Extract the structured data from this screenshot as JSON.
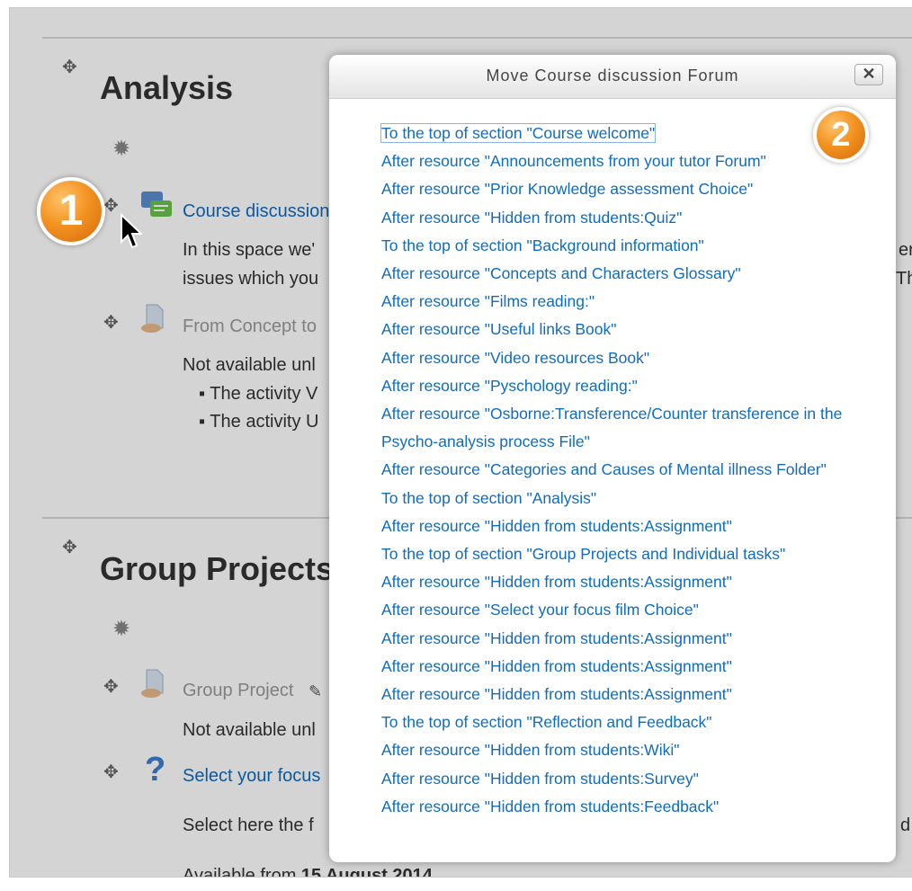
{
  "background": {
    "sections": [
      {
        "title": "Analysis"
      },
      {
        "title": "Group Projects"
      }
    ],
    "activities": {
      "course_discussion_link": "Course discussion",
      "course_discussion_desc_line1": "In this space we'",
      "course_discussion_desc_line2": "issues which you",
      "from_concept_link": "From Concept to",
      "not_available_1": "Not available unl",
      "bullet_1": "The activity V",
      "bullet_2": "The activity U",
      "group_project_link": "Group Project",
      "not_available_2": "Not available unl",
      "select_focus_link": "Select your focus",
      "select_focus_desc": "Select here the f",
      "available_from_prefix": "Available from",
      "available_from_date": "15 August 2014",
      "right_edge_1": "er",
      "right_edge_2": "Th",
      "right_edge_3": "d"
    }
  },
  "badges": {
    "badge1": "1",
    "badge2": "2"
  },
  "dialog": {
    "title": "Move Course discussion Forum",
    "close_label": "✕",
    "options": [
      "To the top of section \"Course welcome\"",
      "After resource \"Announcements from your tutor Forum\"",
      "After resource \"Prior Knowledge assessment Choice\"",
      "After resource \"Hidden from students:Quiz\"",
      "To the top of section \"Background information\"",
      "After resource \"Concepts and Characters Glossary\"",
      "After resource \"Films reading:\"",
      "After resource \"Useful links Book\"",
      "After resource \"Video resources Book\"",
      "After resource \"Pyschology reading:\"",
      "After resource \"Osborne:Transference/Counter transference in the Psycho-analysis process File\"",
      "After resource \"Categories and Causes of Mental illness Folder\"",
      "To the top of section \"Analysis\"",
      "After resource \"Hidden from students:Assignment\"",
      "To the top of section \"Group Projects and Individual tasks\"",
      "After resource \"Hidden from students:Assignment\"",
      "After resource \"Select your focus film Choice\"",
      "After resource \"Hidden from students:Assignment\"",
      "After resource \"Hidden from students:Assignment\"",
      "After resource \"Hidden from students:Assignment\"",
      "To the top of section \"Reflection and Feedback\"",
      "After resource \"Hidden from students:Wiki\"",
      "After resource \"Hidden from students:Survey\"",
      "After resource \"Hidden from students:Feedback\""
    ]
  },
  "colors": {
    "link": "#0f6cbf",
    "badge": "#f39322"
  },
  "icons": [
    "move-icon",
    "gear-icon",
    "forum-icon",
    "resource-icon",
    "question-icon",
    "edit-icon",
    "cursor-icon",
    "close-icon"
  ]
}
